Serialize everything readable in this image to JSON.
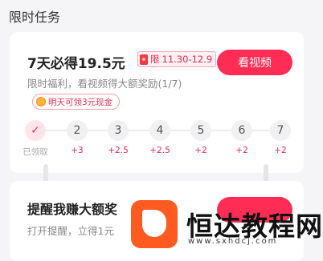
{
  "section": {
    "title": "限时任务"
  },
  "card1": {
    "headline": "7天必得19.5元",
    "badge": {
      "prefix": "限",
      "dates": "11.30-12.9"
    },
    "button": "看视频",
    "subtitle": "限时福利，看视频得大额奖励(1/7)",
    "tomorrow_tip": "明天可领3元现金",
    "days": [
      {
        "label": "✓",
        "reward": "已领取",
        "done": true
      },
      {
        "label": "2",
        "reward": "+3"
      },
      {
        "label": "3",
        "reward": "+2.5"
      },
      {
        "label": "4",
        "reward": "+2.5"
      },
      {
        "label": "5",
        "reward": "+2"
      },
      {
        "label": "6",
        "reward": "+2"
      },
      {
        "label": "7",
        "reward": "+2"
      }
    ]
  },
  "card2": {
    "headline": "提醒我赚大额奖",
    "subtitle": "打开提醒，立得1元"
  },
  "watermark": {
    "name": "恒达教程网",
    "url": "www.sxhdcj.com"
  },
  "colors": {
    "accent": "#ff2d55",
    "logo": "#ff5a1f"
  }
}
